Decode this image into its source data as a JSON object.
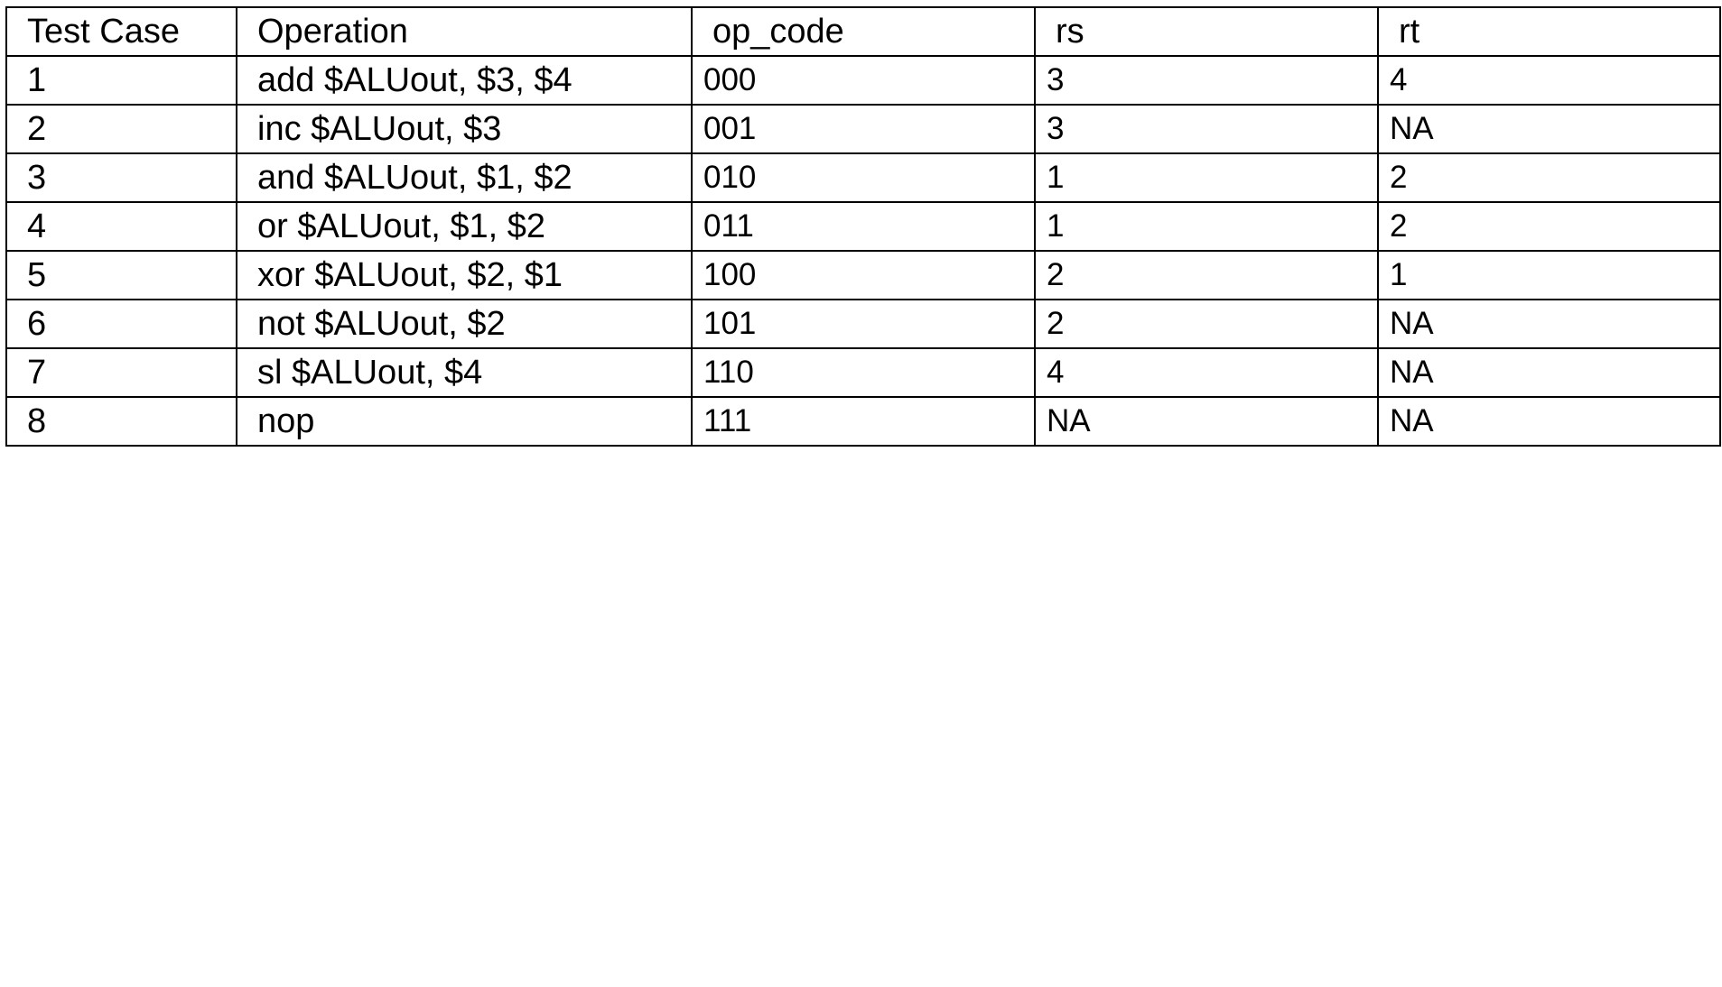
{
  "table": {
    "headers": [
      "Test Case",
      "Operation",
      "op_code",
      "rs",
      "rt"
    ],
    "rows": [
      [
        "1",
        "add $ALUout, $3, $4",
        "000",
        "3",
        "4"
      ],
      [
        "2",
        "inc $ALUout, $3",
        "001",
        "3",
        "NA"
      ],
      [
        "3",
        "and $ALUout, $1, $2",
        "010",
        "1",
        "2"
      ],
      [
        "4",
        "or $ALUout, $1, $2",
        "011",
        "1",
        "2"
      ],
      [
        "5",
        "xor $ALUout, $2, $1",
        "100",
        "2",
        "1"
      ],
      [
        "6",
        "not $ALUout, $2",
        "101",
        "2",
        "NA"
      ],
      [
        "7",
        "sl $ALUout, $4",
        "110",
        "4",
        "NA"
      ],
      [
        "8",
        "nop",
        "111",
        "NA",
        "NA"
      ]
    ]
  }
}
